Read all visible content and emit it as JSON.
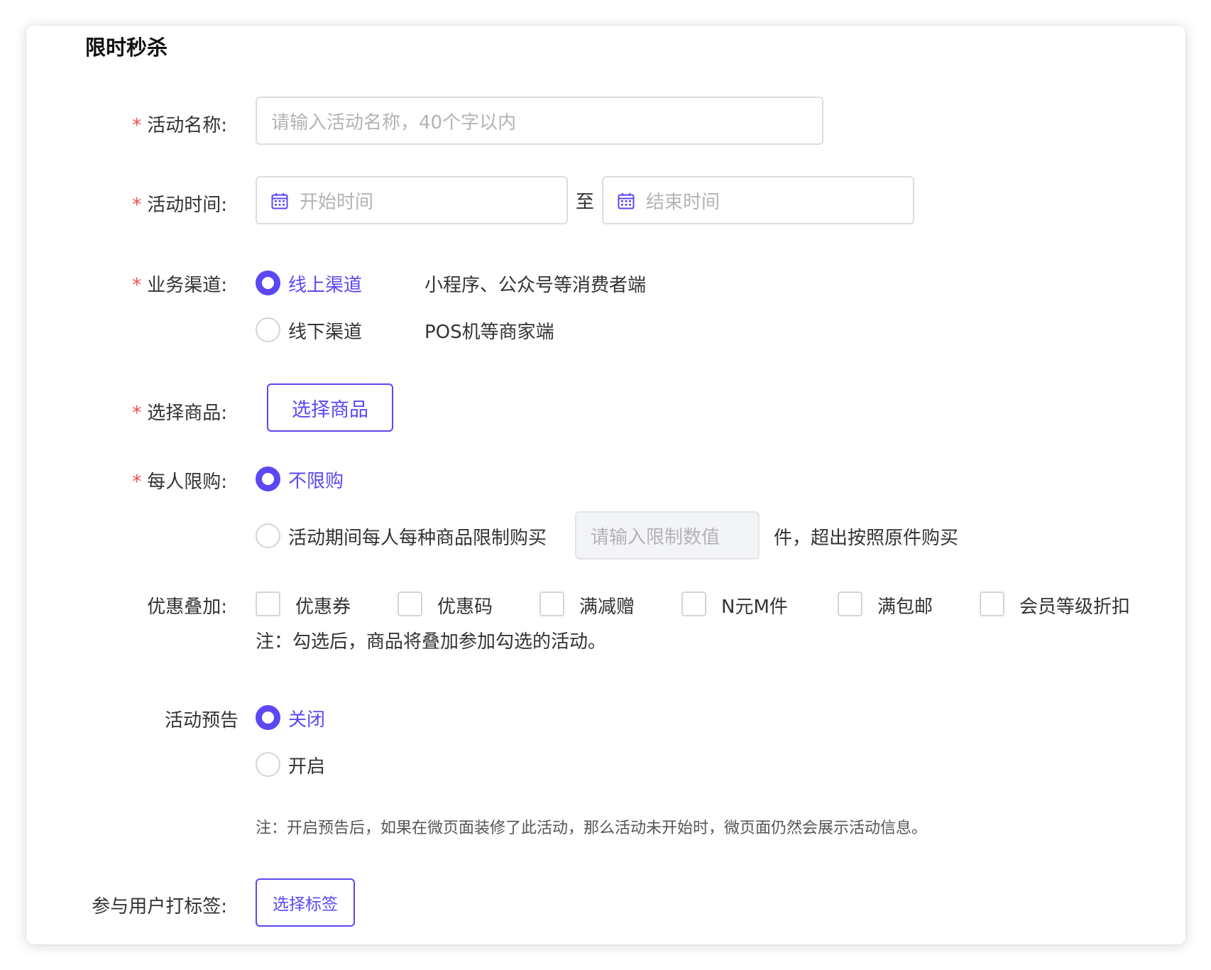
{
  "page_title": "限时秒杀",
  "activity_name": {
    "label": "活动名称:",
    "required_mark": "*",
    "placeholder": "请输入活动名称，40个字以内"
  },
  "activity_time": {
    "label": "活动时间:",
    "required_mark": "*",
    "start_placeholder": "开始时间",
    "separator": "至",
    "end_placeholder": "结束时间",
    "icon": "calendar-icon"
  },
  "channel": {
    "label": "业务渠道:",
    "required_mark": "*",
    "options": [
      {
        "label": "线上渠道",
        "desc": "小程序、公众号等消费者端",
        "selected": true
      },
      {
        "label": "线下渠道",
        "desc": "POS机等商家端",
        "selected": false
      }
    ]
  },
  "goods": {
    "label": "选择商品:",
    "required_mark": "*",
    "button_label": "选择商品"
  },
  "purchase_limit": {
    "label": "每人限购:",
    "required_mark": "*",
    "options": [
      {
        "label": "不限购",
        "selected": true
      },
      {
        "label": "活动期间每人每种商品限制购买",
        "selected": false
      }
    ],
    "limit_placeholder": "请输入限制数值",
    "suffix": "件，超出按照原件购买"
  },
  "stacking": {
    "label": "优惠叠加:",
    "options": [
      {
        "label": "优惠券",
        "checked": false
      },
      {
        "label": "优惠码",
        "checked": false
      },
      {
        "label": "满减赠",
        "checked": false
      },
      {
        "label": "N元M件",
        "checked": false
      },
      {
        "label": "满包邮",
        "checked": false
      },
      {
        "label": "会员等级折扣",
        "checked": false
      }
    ],
    "note": "注：勾选后，商品将叠加参加勾选的活动。"
  },
  "preview": {
    "label": "活动预告",
    "options": [
      {
        "label": "关闭",
        "selected": true
      },
      {
        "label": "开启",
        "selected": false
      }
    ],
    "note": "注：开启预告后，如果在微页面装修了此活动，那么活动未开始时，微页面仍然会展示活动信息。"
  },
  "tags": {
    "label": "参与用户打标签:",
    "button_label": "选择标签"
  },
  "colors": {
    "accent": "#5b48f2",
    "required": "#f04a4a",
    "border": "#dcdde2"
  }
}
